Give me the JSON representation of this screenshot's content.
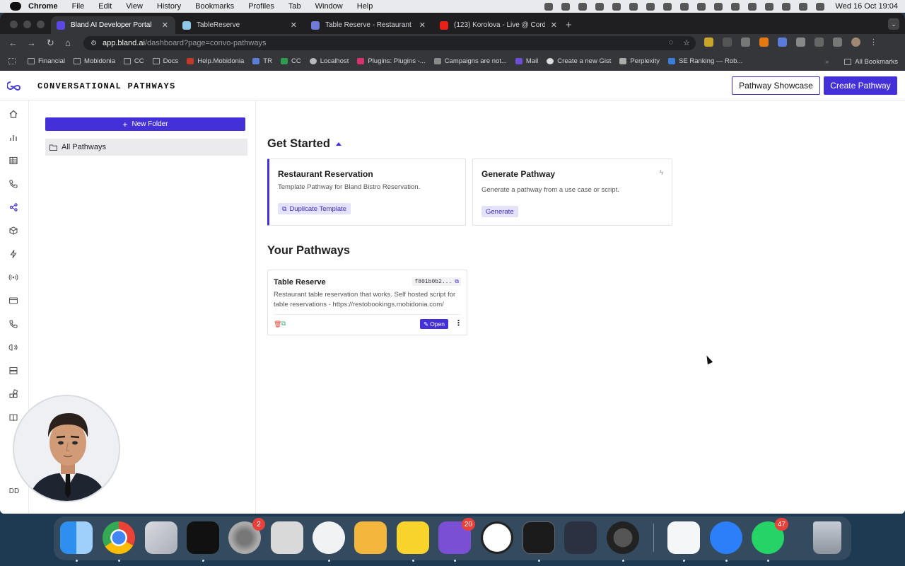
{
  "menubar": {
    "app": "Chrome",
    "items": [
      "File",
      "Edit",
      "View",
      "History",
      "Bookmarks",
      "Profiles",
      "Tab",
      "Window",
      "Help"
    ],
    "clock": "Wed 16 Oct  19:04"
  },
  "tabs": [
    {
      "label": "Bland AI Developer Portal",
      "active": true
    },
    {
      "label": "TableReserve",
      "active": false
    },
    {
      "label": "Table Reserve - Restaurant R",
      "active": false
    },
    {
      "label": "(123) Korolova - Live @ Cord",
      "active": false
    }
  ],
  "address": {
    "host": "app.bland.ai",
    "path": "/dashboard?page=convo-pathways"
  },
  "bookmarks": [
    "Financial",
    "Mobidonia",
    "CC",
    "Docs",
    "Help.Mobidonia",
    "TR",
    "CC",
    "Localhost",
    "Plugins: Plugins -...",
    "Campaigns are not...",
    "Mail",
    "Create a new Gist",
    "Perplexity",
    "SE Ranking — Rob..."
  ],
  "bookmarks_right": "All Bookmarks",
  "app": {
    "title": "CONVERSATIONAL PATHWAYS",
    "showcase_label": "Pathway Showcase",
    "create_label": "Create Pathway",
    "user_initials": "DD",
    "new_folder_label": "New Folder",
    "folder_all": "All Pathways",
    "get_started": "Get Started",
    "your_pathways": "Your Pathways",
    "card_reservation": {
      "title": "Restaurant Reservation",
      "desc": "Template Pathway for Bland Bistro Reservation.",
      "action": "Duplicate Template"
    },
    "card_generate": {
      "title": "Generate Pathway",
      "desc": "Generate a pathway from a use case or script.",
      "action": "Generate"
    },
    "pathway": {
      "title": "Table Reserve",
      "id": "f801b0b2...",
      "desc": "Restaurant table reservation that works. Self hosted script for table reservations - https://restobookings.mobidonia.com/",
      "open_label": "Open"
    }
  },
  "dock_badges": {
    "settings": "2",
    "viber": "20",
    "whatsapp": "47"
  },
  "colors": {
    "accent": "#4330d9",
    "accent_soft": "#e4e1fb"
  }
}
